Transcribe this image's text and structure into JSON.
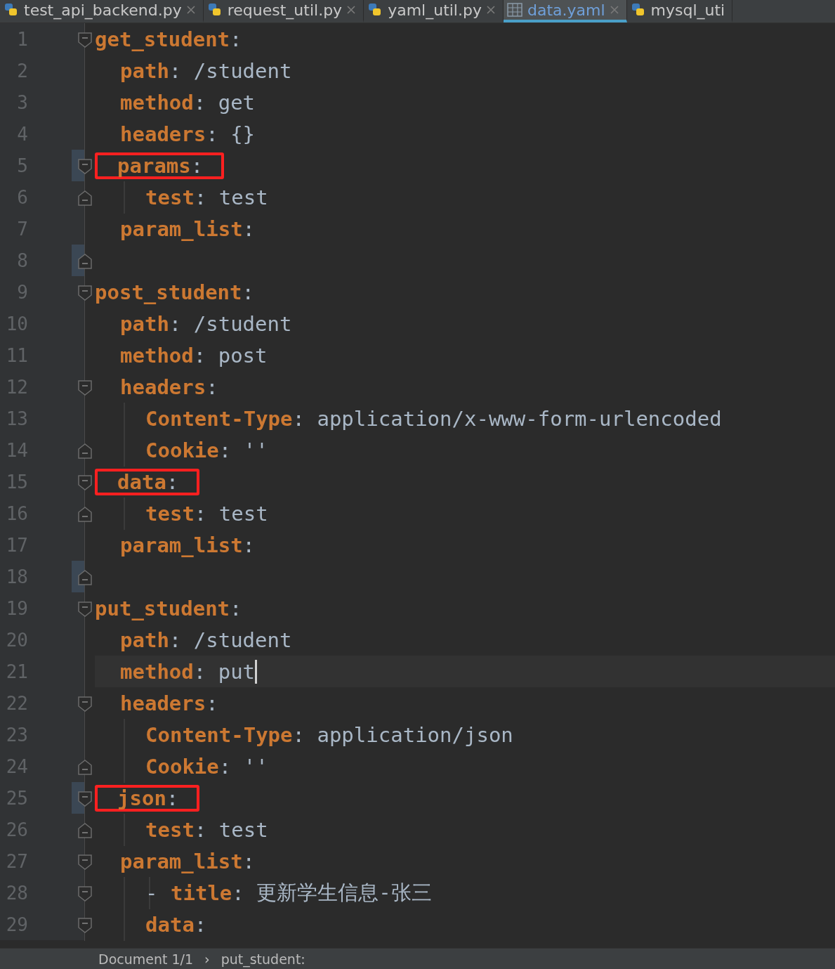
{
  "tabs": [
    {
      "label": "test_api_backend.py",
      "kind": "python",
      "selected": false
    },
    {
      "label": "request_util.py",
      "kind": "python",
      "selected": false
    },
    {
      "label": "yaml_util.py",
      "kind": "python",
      "selected": false
    },
    {
      "label": "data.yaml",
      "kind": "yaml",
      "selected": true
    },
    {
      "label": "mysql_uti",
      "kind": "python",
      "selected": false
    }
  ],
  "lines": [
    {
      "number": "1",
      "key": "get_student",
      "colon": ":",
      "fold_start": true,
      "children": [
        {
          "number": "2",
          "key": "path",
          "colon": ":",
          "value": "/student"
        },
        {
          "number": "3",
          "key": "method",
          "colon": ":",
          "value": "get"
        },
        {
          "number": "4",
          "key": "headers",
          "colon": ":",
          "value": "{}"
        },
        {
          "number": "5",
          "key": "params",
          "colon": ":",
          "fold_start": true,
          "gutter_mark": true,
          "boxed": true,
          "children": [
            {
              "number": "6",
              "key": "test",
              "colon": ":",
              "value": "test",
              "fold_end": true
            }
          ]
        },
        {
          "number": "7",
          "key": "param_list",
          "colon": ":"
        }
      ]
    },
    {
      "number": "8",
      "fold_end": true,
      "gutter_mark": true
    },
    {
      "number": "9",
      "key": "post_student",
      "colon": ":",
      "fold_start": true,
      "children": [
        {
          "number": "10",
          "key": "path",
          "colon": ":",
          "value": "/student"
        },
        {
          "number": "11",
          "key": "method",
          "colon": ":",
          "value": "post"
        },
        {
          "number": "12",
          "key": "headers",
          "colon": ":",
          "fold_start": true,
          "children": [
            {
              "number": "13",
              "key": "Content-Type",
              "colon": ":",
              "value": "application/x-www-form-urlencoded"
            },
            {
              "number": "14",
              "key": "Cookie",
              "colon": ":",
              "value": "''",
              "fold_end": true
            }
          ]
        },
        {
          "number": "15",
          "key": "data",
          "colon": ":",
          "fold_start": true,
          "boxed": true,
          "children": [
            {
              "number": "16",
              "key": "test",
              "colon": ":",
              "value": "test",
              "fold_end": true
            }
          ]
        },
        {
          "number": "17",
          "key": "param_list",
          "colon": ":"
        }
      ]
    },
    {
      "number": "18",
      "fold_end": true,
      "gutter_mark": true
    },
    {
      "number": "19",
      "key": "put_student",
      "colon": ":",
      "fold_start": true,
      "children": [
        {
          "number": "20",
          "key": "path",
          "colon": ":",
          "value": "/student"
        },
        {
          "number": "21",
          "key": "method",
          "colon": ":",
          "value": "put",
          "cursor": true
        },
        {
          "number": "22",
          "key": "headers",
          "colon": ":",
          "fold_start": true,
          "children": [
            {
              "number": "23",
              "key": "Content-Type",
              "colon": ":",
              "value": "application/json"
            },
            {
              "number": "24",
              "key": "Cookie",
              "colon": ":",
              "value": "''",
              "fold_end": true
            }
          ]
        },
        {
          "number": "25",
          "key": "json",
          "colon": ":",
          "fold_start": true,
          "gutter_mark": true,
          "boxed": true,
          "children": [
            {
              "number": "26",
              "key": "test",
              "colon": ":",
              "value": "test",
              "fold_end": true
            }
          ]
        },
        {
          "number": "27",
          "key": "param_list",
          "colon": ":",
          "fold_start": true,
          "children": [
            {
              "number": "28",
              "dash": "-",
              "key": "title",
              "colon": ":",
              "value": "更新学生信息-张三",
              "fold_start": true,
              "children": [
                {
                  "number": "29",
                  "key": "data",
                  "colon": ":",
                  "fold_start": true
                }
              ]
            }
          ]
        }
      ]
    }
  ],
  "status_bar": {
    "document": "Document 1/1",
    "separator": "›",
    "path": "put_student:"
  }
}
